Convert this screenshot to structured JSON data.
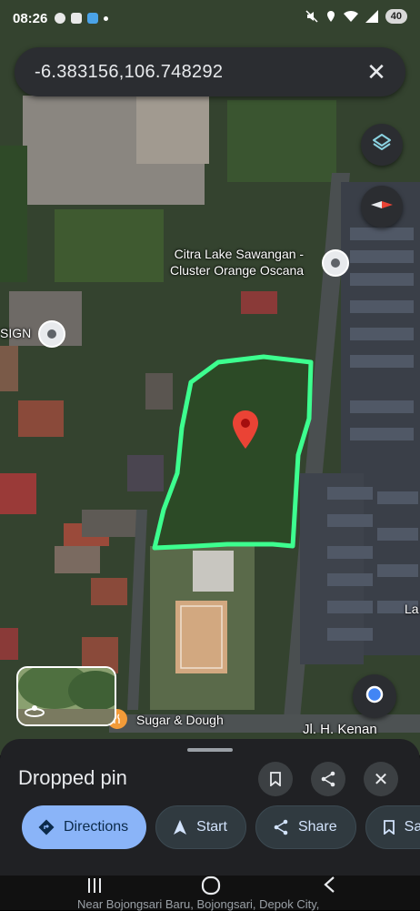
{
  "status_bar": {
    "time": "08:26",
    "battery": "40"
  },
  "search": {
    "query": "-6.383156,106.748292",
    "close_icon": "close-icon"
  },
  "map": {
    "places": [
      {
        "name": "Citra Lake Sawangan -\nCluster Orange Oscana"
      },
      {
        "name": "SIGN"
      },
      {
        "name": "Sugar & Dough"
      }
    ],
    "streets": [
      {
        "name": "Jl. H. Kenan"
      },
      {
        "name": "La"
      }
    ],
    "pin_color": "#ea4335",
    "outline_color": "#3dff8f",
    "compass_icon": "compass-icon",
    "layers_icon": "layers-icon",
    "my_location_icon": "my-location-icon",
    "street_view_icon": "street-view-icon",
    "restaurant_icon": "restaurant-icon"
  },
  "sheet": {
    "title": "Dropped pin",
    "icons": [
      "bookmark-icon",
      "share-icon",
      "close-icon"
    ],
    "chips": [
      {
        "label": "Directions",
        "icon": "directions-icon"
      },
      {
        "label": "Start",
        "icon": "navigation-icon"
      },
      {
        "label": "Share",
        "icon": "share-icon"
      },
      {
        "label": "Sa",
        "icon": "bookmark-icon"
      }
    ]
  },
  "nav_hint": "Near Bojongsari Baru, Bojongsari, Depok City,"
}
